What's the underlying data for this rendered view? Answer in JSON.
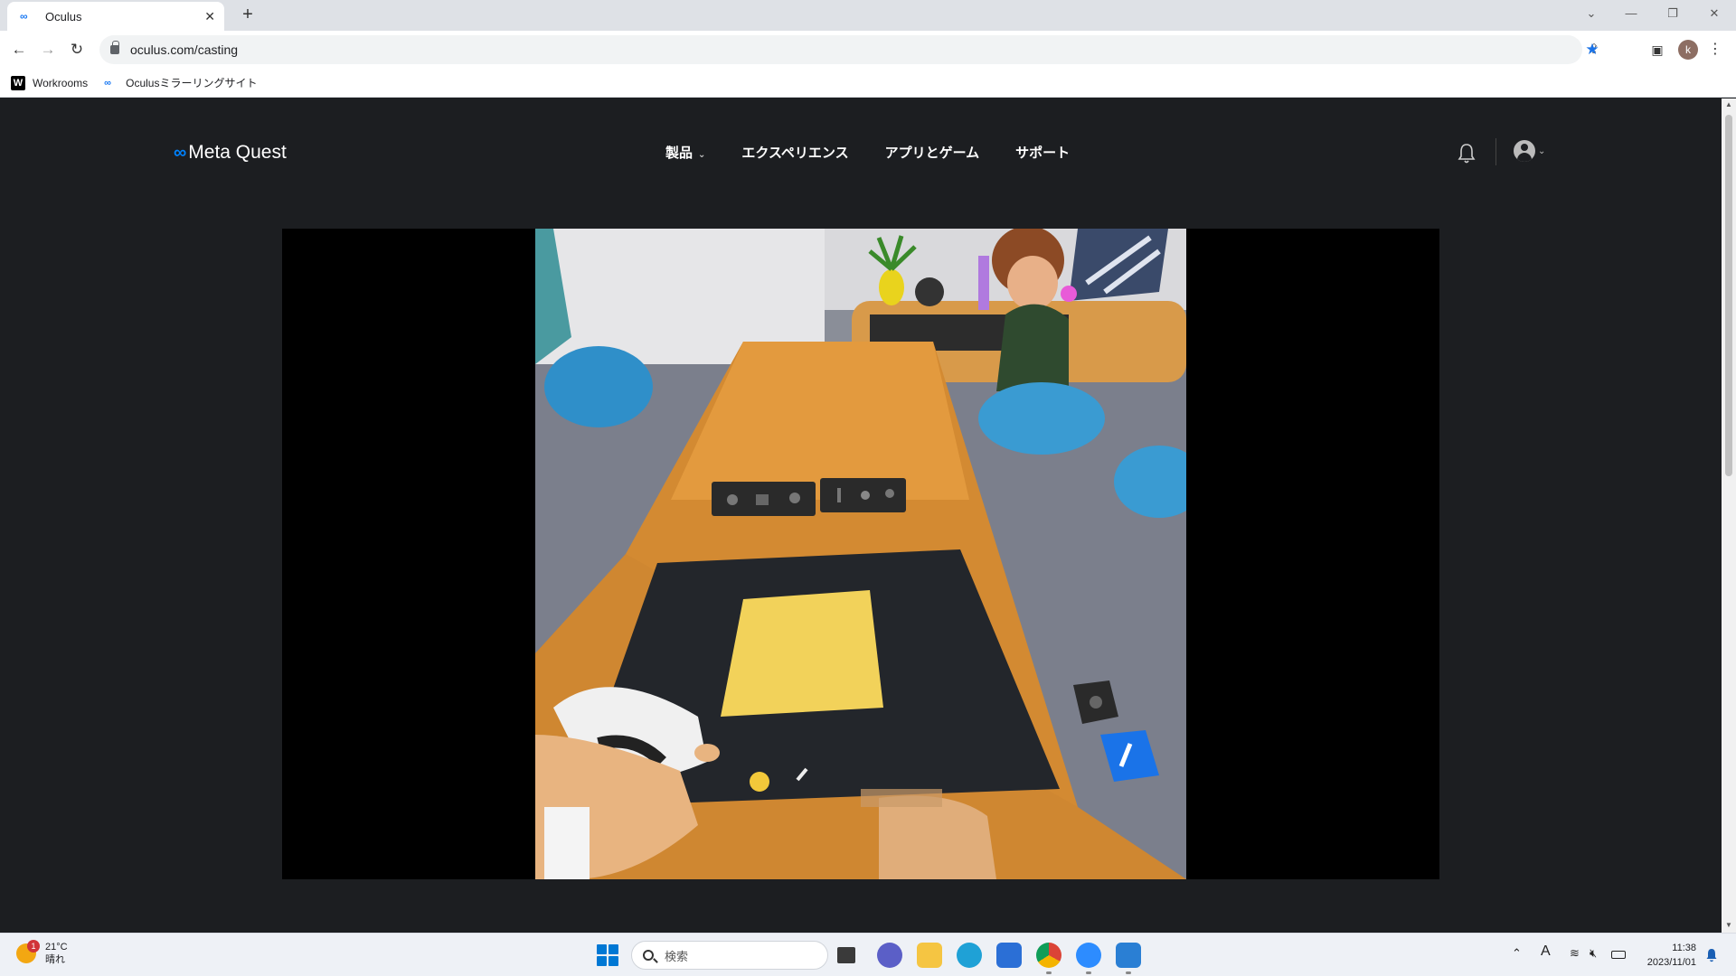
{
  "browser": {
    "tab_title": "Oculus",
    "tab_favicon": "∞",
    "new_tab": "+",
    "close_tab": "✕",
    "url": "oculus.com/casting",
    "profile_initial": "k",
    "bookmarks": [
      {
        "label": "Workrooms",
        "icon": "W"
      },
      {
        "label": "Oculusミラーリングサイト",
        "icon": "∞"
      }
    ]
  },
  "site": {
    "brand": "Meta Quest",
    "brand_icon": "∞",
    "nav": [
      {
        "label": "製品",
        "has_dropdown": true
      },
      {
        "label": "エクスペリエンス"
      },
      {
        "label": "アプリとゲーム"
      },
      {
        "label": "サポート"
      }
    ]
  },
  "taskbar": {
    "weather_temp": "21°C",
    "weather_desc": "晴れ",
    "weather_badge": "1",
    "search_placeholder": "検索",
    "time": "11:38",
    "date": "2023/11/01",
    "ime": "A"
  },
  "colors": {
    "page_bg": "#1c1e21",
    "meta_blue": "#0081fb",
    "accent_blue": "#1a73e8"
  }
}
